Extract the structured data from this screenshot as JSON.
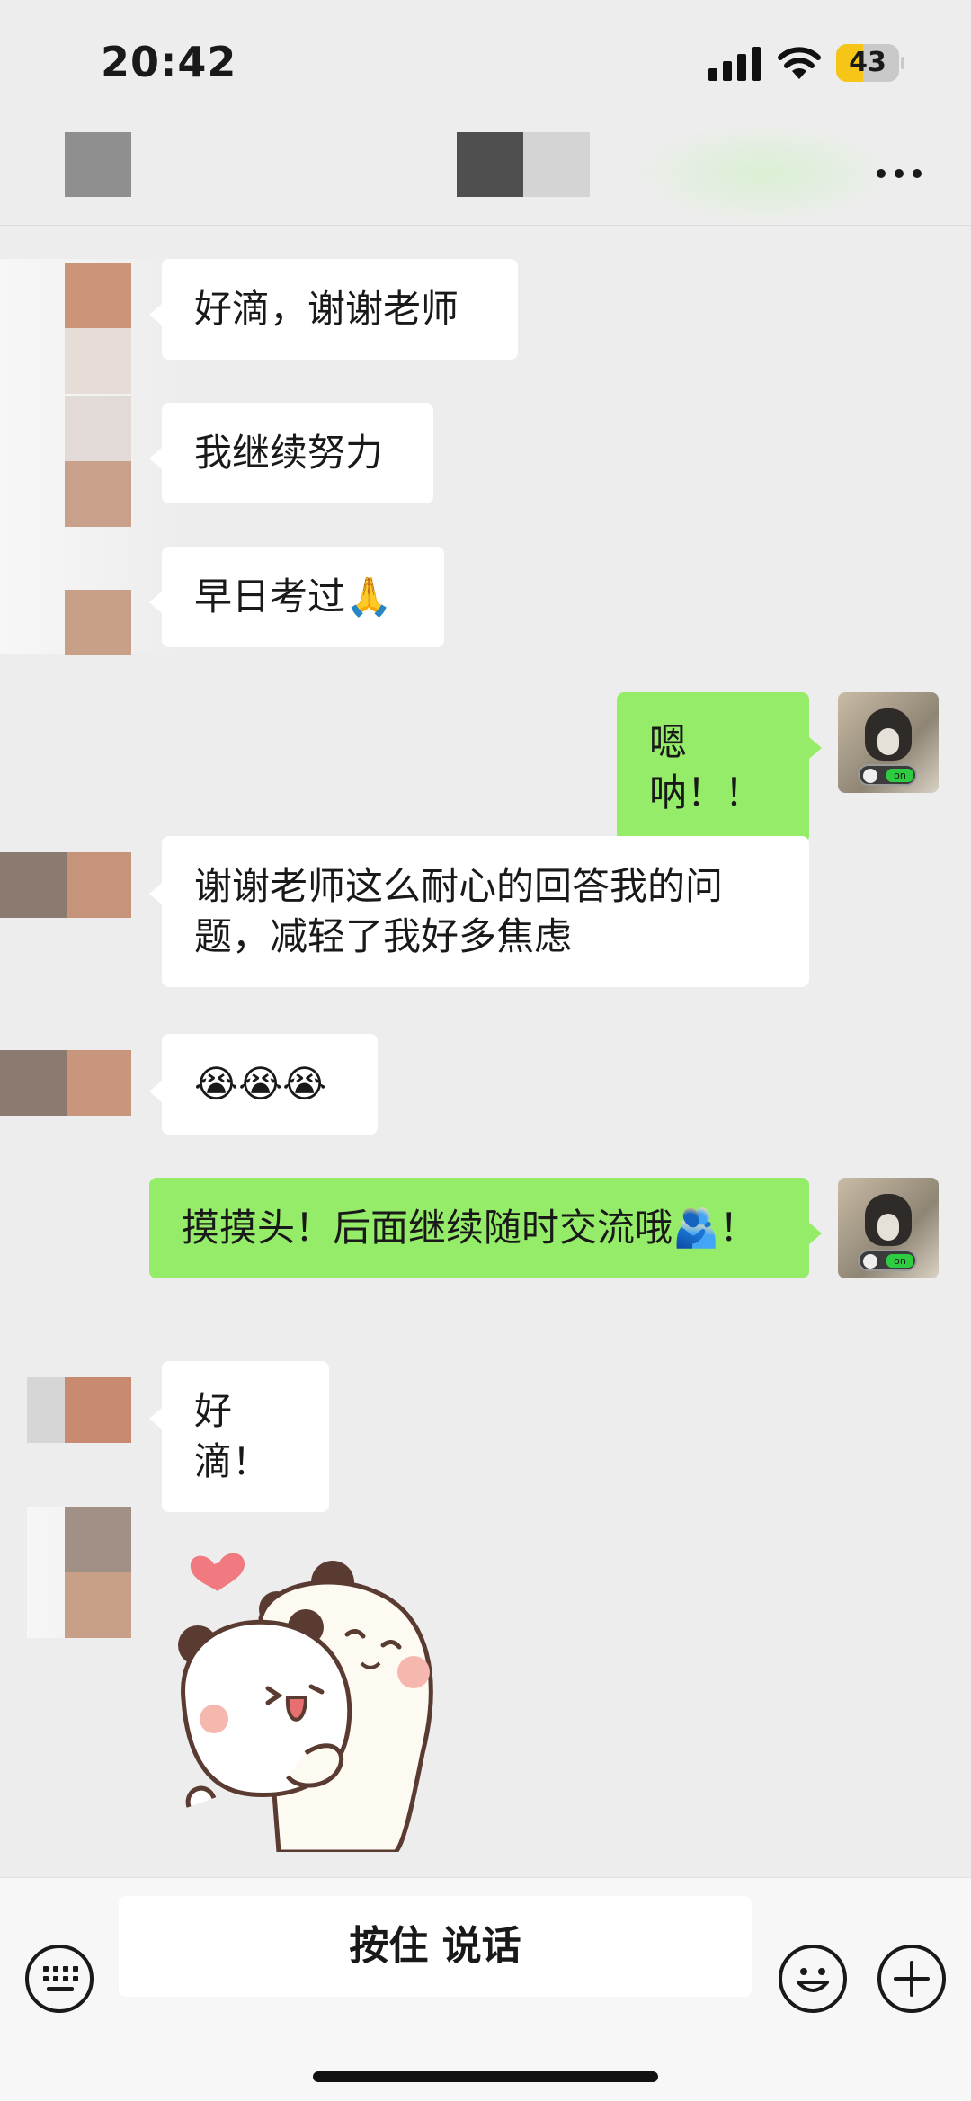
{
  "status_bar": {
    "time": "20:42",
    "battery_level": "43",
    "battery_fill_fraction": 0.43,
    "signal_icon": "cellular-signal-icon",
    "wifi_icon": "wifi-icon"
  },
  "header": {
    "more_icon": "more-icon"
  },
  "messages": [
    {
      "side": "in",
      "text": "好滴，谢谢老师"
    },
    {
      "side": "in",
      "text": "我继续努力"
    },
    {
      "side": "in",
      "text": "早日考过🙏"
    },
    {
      "side": "out",
      "text": "嗯呐！！"
    },
    {
      "side": "in",
      "text": "谢谢老师这么耐心的回答我的问题，减轻了我好多焦虑"
    },
    {
      "side": "in",
      "text": "😭😭😭"
    },
    {
      "side": "out",
      "text": "摸摸头！后面继续随时交流哦🫂！"
    },
    {
      "side": "in",
      "text": "好滴！"
    },
    {
      "side": "in",
      "type": "sticker",
      "sticker": "panda-hug-sticker"
    }
  ],
  "my_avatar": {
    "toggle_text": "on"
  },
  "input_bar": {
    "voice_label": "按住 说话",
    "left_icon": "keyboard-icon",
    "emoji_icon": "emoji-icon",
    "add_icon": "add-icon"
  },
  "colors": {
    "background": "#ededed",
    "outgoing_bubble": "#95ec69",
    "incoming_bubble": "#ffffff"
  }
}
